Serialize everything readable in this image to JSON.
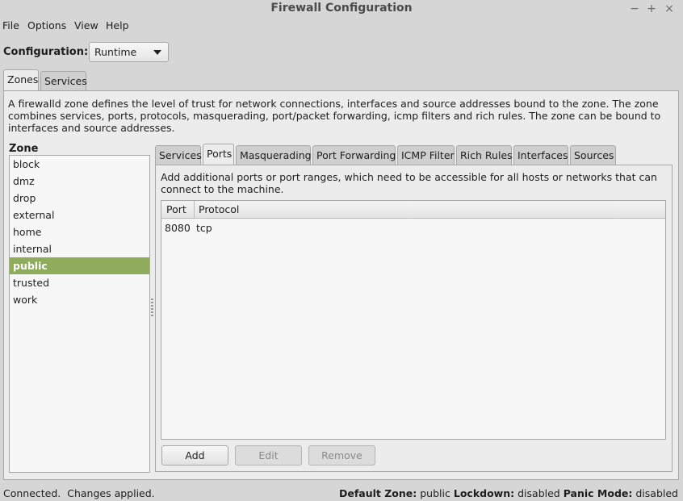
{
  "window": {
    "title": "Firewall Configuration",
    "controls": {
      "minimize": "−",
      "maximize": "+",
      "close": "×"
    }
  },
  "menu": [
    "File",
    "Options",
    "View",
    "Help"
  ],
  "configuration": {
    "label": "Configuration:",
    "value": "Runtime"
  },
  "main_tabs": [
    {
      "label": "Zones",
      "active": true
    },
    {
      "label": "Services",
      "active": false
    }
  ],
  "zone_description": "A firewalld zone defines the level of trust for network connections, interfaces and source addresses bound to the zone. The zone combines services, ports, protocols, masquerading, port/packet forwarding, icmp filters and rich rules. The zone can be bound to interfaces and source addresses.",
  "zone_list": {
    "header": "Zone",
    "items": [
      "block",
      "dmz",
      "drop",
      "external",
      "home",
      "internal",
      "public",
      "trusted",
      "work"
    ],
    "selected": "public"
  },
  "zone_tabs": [
    {
      "label": "Services",
      "active": false
    },
    {
      "label": "Ports",
      "active": true
    },
    {
      "label": "Masquerading",
      "active": false
    },
    {
      "label": "Port Forwarding",
      "active": false
    },
    {
      "label": "ICMP Filter",
      "active": false
    },
    {
      "label": "Rich Rules",
      "active": false
    },
    {
      "label": "Interfaces",
      "active": false
    },
    {
      "label": "Sources",
      "active": false
    }
  ],
  "ports": {
    "description": "Add additional ports or port ranges, which need to be accessible for all hosts or networks that can connect to the machine.",
    "columns": [
      "Port",
      "Protocol"
    ],
    "rows": [
      {
        "port": "8080",
        "protocol": "tcp"
      }
    ],
    "buttons": {
      "add": "Add",
      "edit": "Edit",
      "remove": "Remove"
    }
  },
  "status": {
    "left": "Connected.  Changes applied.",
    "default_zone_label": "Default Zone:",
    "default_zone_value": "public",
    "lockdown_label": "Lockdown:",
    "lockdown_value": "disabled",
    "panic_label": "Panic Mode:",
    "panic_value": "disabled"
  },
  "colors": {
    "selection": "#8eac5c",
    "background": "#d6d6d6",
    "panel": "#ececec"
  }
}
